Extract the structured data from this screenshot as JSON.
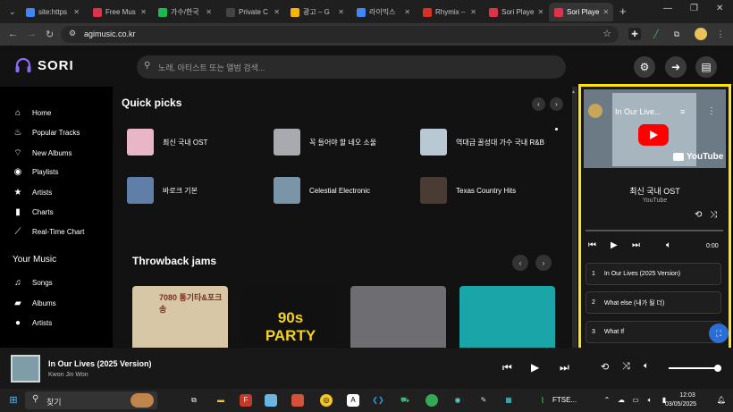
{
  "browser": {
    "tabs": [
      {
        "label": "site:https",
        "color": "#4285f4"
      },
      {
        "label": "Free Mus",
        "color": "#e0314b"
      },
      {
        "label": "가수/한국",
        "color": "#1db954"
      },
      {
        "label": "Private C",
        "color": "#444444"
      },
      {
        "label": "광고 – G",
        "color": "#f4b400"
      },
      {
        "label": "라이믹스",
        "color": "#4285f4"
      },
      {
        "label": "Rhymix –",
        "color": "#d93025"
      },
      {
        "label": "Sori Playe",
        "color": "#e0314b"
      },
      {
        "label": "Sori Playe",
        "color": "#e0314b"
      }
    ],
    "new_tab": "+",
    "url": "agimusic.co.kr"
  },
  "app": {
    "logo": "SORI",
    "search_placeholder": "노래, 아티스트 또는 앨범 검색..."
  },
  "sidebar": {
    "items": [
      {
        "label": "Home",
        "icon": "home-icon"
      },
      {
        "label": "Popular Tracks",
        "icon": "fire-icon"
      },
      {
        "label": "New Albums",
        "icon": "wifi-icon"
      },
      {
        "label": "Playlists",
        "icon": "podcast-icon"
      },
      {
        "label": "Artists",
        "icon": "star-icon"
      },
      {
        "label": "Charts",
        "icon": "bar-chart-icon"
      },
      {
        "label": "Real-Time Chart",
        "icon": "line-chart-icon"
      }
    ],
    "your_music_title": "Your Music",
    "music_items": [
      {
        "label": "Songs",
        "icon": "music-icon"
      },
      {
        "label": "Albums",
        "icon": "albums-icon"
      },
      {
        "label": "Artists",
        "icon": "user-icon"
      }
    ]
  },
  "main": {
    "quick_picks_title": "Quick picks",
    "quick_picks": [
      {
        "label": "최신 국내 OST",
        "color": "#e9b6c7"
      },
      {
        "label": "꼭 들어야 할 네오 소울",
        "color": "#a8aab0"
      },
      {
        "label": "역대급 꿀성대 가수 국내 R&B",
        "color": "#b9c9d3"
      },
      {
        "label": "바로크 기본",
        "color": "#5f7ea8"
      },
      {
        "label": "Celestial Electronic",
        "color": "#7b95a8"
      },
      {
        "label": "Texas Country Hits",
        "color": "#4a3b35"
      }
    ],
    "throwback_title": "Throwback jams",
    "tiles": [
      {
        "name": "7080-tile",
        "color": "#d8c7a6",
        "text": "7080 통기타&포크송"
      },
      {
        "name": "90s-party-tile",
        "color": "#111111",
        "text": "90s PARTY"
      },
      {
        "name": "portrait-tile",
        "color": "#6e6e72",
        "text": ""
      },
      {
        "name": "colorful-tile",
        "color": "#1aa5a8",
        "text": ""
      }
    ]
  },
  "panel": {
    "video_title": "In Our Live...",
    "video_brand": "YouTube",
    "playlist_title": "최신 국내 OST",
    "source": "YouTube",
    "time": "0:00",
    "tracks": [
      {
        "num": "1",
        "title": "In Our Lives (2025 Version)"
      },
      {
        "num": "2",
        "title": "What else (내가 될 더)"
      },
      {
        "num": "3",
        "title": "What If"
      }
    ]
  },
  "now_playing": {
    "title": "In Our Lives (2025 Version)",
    "artist": "Kwon Jin Won",
    "volume": 0.95
  },
  "taskbar": {
    "search_label": "찾기",
    "ticker": "FTSE...",
    "time": "12:03",
    "date": "03/05/2025"
  }
}
